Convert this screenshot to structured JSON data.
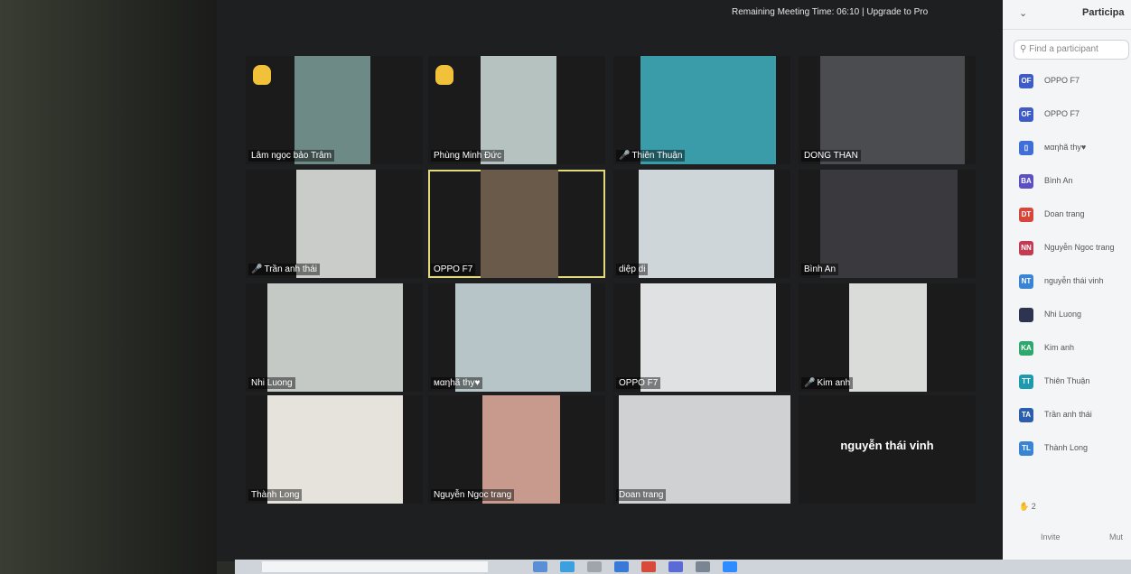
{
  "banner": "Remaining Meeting Time: 06:10 | Upgrade to Pro",
  "tiles": [
    {
      "name": "Lâm ngọc bảo Trâm",
      "hand": true
    },
    {
      "name": "Phùng Minh Đức",
      "hand": true
    },
    {
      "name": "Thiên Thuận",
      "muted": true
    },
    {
      "name": "DONG THAN"
    },
    {
      "name": "Trần anh thái",
      "muted": true
    },
    {
      "name": "OPPO F7",
      "active": true
    },
    {
      "name": "diệp di"
    },
    {
      "name": "Bình An"
    },
    {
      "name": "Nhi Luong"
    },
    {
      "name": "мαηhã thy♥"
    },
    {
      "name": "OPPO F7"
    },
    {
      "name": "Kim anh",
      "muted": true
    },
    {
      "name": "Thành Long"
    },
    {
      "name": "Nguyễn Ngoc trang"
    },
    {
      "name": "Doan trang"
    },
    {
      "name": "nguyễn thái vinh",
      "no_video": true
    }
  ],
  "panel": {
    "title": "Participa",
    "collapse_glyph": "⌄",
    "search_placeholder": "Find a participant",
    "participants": [
      {
        "initials": "OF",
        "name": "OPPO F7",
        "color": "#3f5bc7"
      },
      {
        "initials": "OF",
        "name": "OPPO F7",
        "color": "#3f5bc7"
      },
      {
        "initials": "▯",
        "name": "мαηhã thy♥",
        "color": "#3f6fd6"
      },
      {
        "initials": "BA",
        "name": "Bình An",
        "color": "#5b4fc4"
      },
      {
        "initials": "DT",
        "name": "Doan trang",
        "color": "#d8453a"
      },
      {
        "initials": "NN",
        "name": "Nguyễn Ngoc trang",
        "color": "#c43a53"
      },
      {
        "initials": "NT",
        "name": "nguyễn thái vinh",
        "color": "#3a84d6"
      },
      {
        "initials": "",
        "name": "Nhi Luong",
        "color": "#2e3350"
      },
      {
        "initials": "KA",
        "name": "Kim anh",
        "color": "#2fa86d"
      },
      {
        "initials": "TT",
        "name": "Thiên Thuận",
        "color": "#1c9bb0"
      },
      {
        "initials": "TA",
        "name": "Trần anh thái",
        "color": "#2b5fae"
      },
      {
        "initials": "TL",
        "name": "Thành Long",
        "color": "#3a84d6"
      }
    ],
    "raised_hands": "2",
    "invite_label": "Invite",
    "mute_label": "Mut"
  },
  "colors": {
    "active_border": "#e3d87a",
    "hand": "#f2c13a",
    "muted_mic": "#e24a4a"
  }
}
